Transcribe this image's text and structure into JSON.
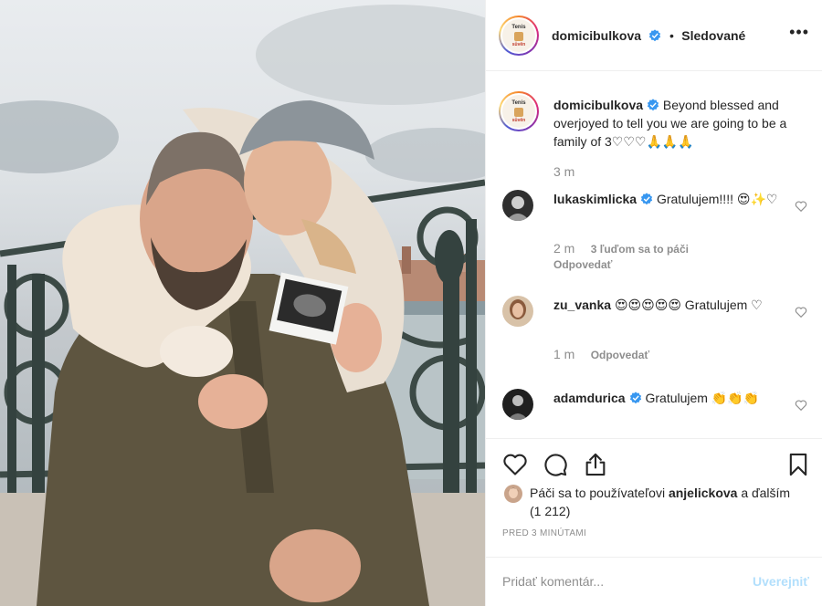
{
  "post": {
    "username": "domicibulkova",
    "follow_state": "Sledované",
    "separator": "•",
    "more_label": "•••",
    "avatar_text_top": "Tenis",
    "avatar_text_bottom": "sůvěn",
    "verified_color": "#3897f0"
  },
  "caption": {
    "username": "domicibulkova",
    "text": "Beyond blessed and overjoyed to tell you we are going to be a family of 3♡♡♡🙏🙏🙏",
    "time": "3 m"
  },
  "comments": [
    {
      "username": "lukaskimlicka",
      "verified": true,
      "text": "Gratulujem!!!! 😍✨♡",
      "time": "2 m",
      "likes": "3 ľuďom sa to páči",
      "reply": "Odpovedať"
    },
    {
      "username": "zu_vanka",
      "verified": false,
      "text": "😍😍😍😍😍 Gratulujem ♡",
      "time": "1 m",
      "reply": "Odpovedať"
    },
    {
      "username": "adamdurica",
      "verified": true,
      "text": "Gratulujem 👏👏👏"
    }
  ],
  "actions": {
    "like_icon": "heart-icon",
    "comment_icon": "comment-icon",
    "share_icon": "share-icon",
    "save_icon": "bookmark-icon"
  },
  "likes": {
    "prefix": "Páči sa to používateľovi",
    "user": "anjelickova",
    "suffix": "a ďalším (1 212)"
  },
  "timestamp": "PRED 3 MINÚTAMI",
  "comment_box": {
    "placeholder": "Pridať komentár...",
    "post_label": "Uverejniť"
  },
  "colors": {
    "text": "#262626",
    "secondary": "#8e8e8e",
    "border": "#efefef",
    "post_button_disabled": "#b2dffc"
  }
}
